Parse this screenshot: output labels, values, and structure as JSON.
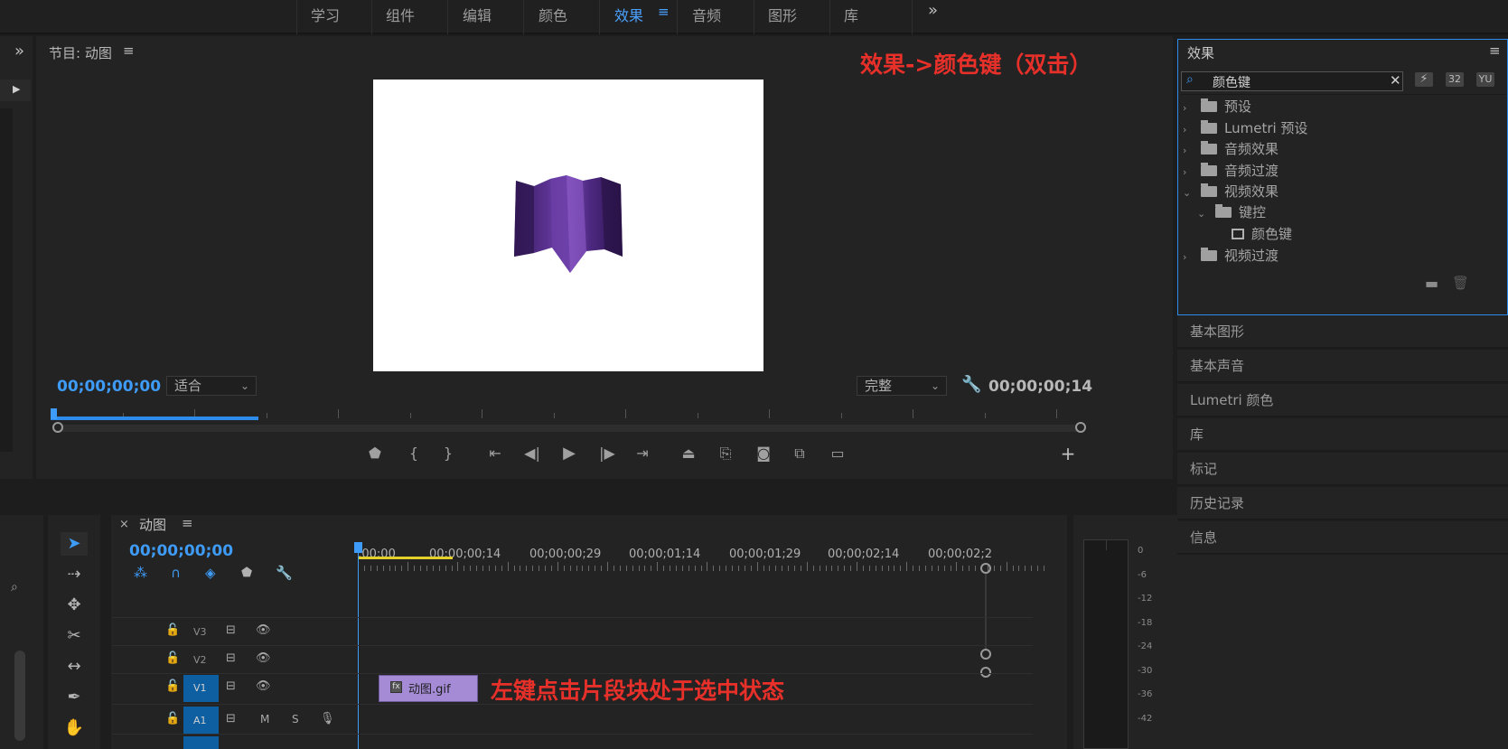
{
  "workspace_tabs": [
    "学习",
    "组件",
    "编辑",
    "颜色",
    "效果",
    "音频",
    "图形",
    "库"
  ],
  "workspace_active_index": 4,
  "workspace_menu_icon": "hamburger-icon",
  "workspace_more_icon": "double-chevron-right-icon",
  "program": {
    "title": "节目: 动图",
    "timecode_left": "00;00;00;00",
    "fit_label": "适合",
    "quality_label": "完整",
    "timecode_right": "00;00;00;14",
    "playhead_progress": 0.0,
    "in_out_fill": 0.2
  },
  "annotation_effects": "效果->颜色键（双击）",
  "annotation_clip": "左键点击片段块处于选中状态",
  "effects_panel": {
    "title": "效果",
    "search_value": "颜色键",
    "tree": [
      {
        "label": "预设",
        "expanded": false,
        "depth": 0,
        "type": "folder-star"
      },
      {
        "label": "Lumetri 预设",
        "expanded": false,
        "depth": 0,
        "type": "folder-star"
      },
      {
        "label": "音频效果",
        "expanded": false,
        "depth": 0,
        "type": "folder"
      },
      {
        "label": "音频过渡",
        "expanded": false,
        "depth": 0,
        "type": "folder"
      },
      {
        "label": "视频效果",
        "expanded": true,
        "depth": 0,
        "type": "folder"
      },
      {
        "label": "键控",
        "expanded": true,
        "depth": 1,
        "type": "folder"
      },
      {
        "label": "颜色键",
        "expanded": false,
        "depth": 2,
        "type": "effect"
      },
      {
        "label": "视频过渡",
        "expanded": false,
        "depth": 0,
        "type": "folder"
      }
    ],
    "badge_32": "32",
    "badge_yuv": "YU"
  },
  "collapsed_panels": [
    "基本图形",
    "基本声音",
    "Lumetri 颜色",
    "库",
    "标记",
    "历史记录",
    "信息"
  ],
  "timeline": {
    "title": "动图",
    "timecode": "00;00;00;00",
    "ruler_labels": [
      ";00;00",
      "00;00;00;14",
      "00;00;00;29",
      "00;00;01;14",
      "00;00;01;29",
      "00;00;02;14",
      "00;00;02;2"
    ],
    "tracks": [
      {
        "name": "V3"
      },
      {
        "name": "V2"
      },
      {
        "name": "V1"
      },
      {
        "name": "A1"
      }
    ],
    "audio_m": "M",
    "audio_s": "S",
    "clip_label": "动图.gif",
    "clip_color": "#a58bd6"
  },
  "meter_labels": [
    "0",
    "-6",
    "-12",
    "-18",
    "-24",
    "-30",
    "-36",
    "-42"
  ],
  "colors": {
    "accent": "#2d8ceb",
    "annotation": "#e8302a",
    "playhead": "#3e9bf7"
  }
}
